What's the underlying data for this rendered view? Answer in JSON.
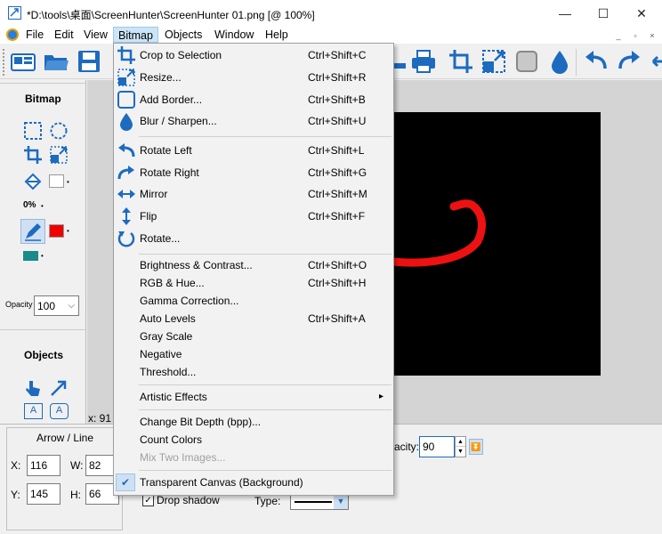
{
  "window": {
    "title": "*D:\\tools\\桌面\\ScreenHunter\\ScreenHunter 01.png [@ 100%]",
    "minimize": "—",
    "maximize": "☐",
    "close": "✕"
  },
  "menubar": {
    "items": [
      "File",
      "Edit",
      "View",
      "Bitmap",
      "Objects",
      "Window",
      "Help"
    ],
    "mdi": [
      "_",
      "▫",
      "×"
    ]
  },
  "left_panel": {
    "bitmap_title": "Bitmap",
    "zoom_value": "0%",
    "opacity_label": "Opacity",
    "opacity_value": "100",
    "objects_title": "Objects",
    "text_tool_a": "A",
    "text_tool_b": "A"
  },
  "canvas": {
    "coords": "x: 91"
  },
  "bottom_panel": {
    "section_title": "Arrow / Line",
    "x_label": "X:",
    "x_value": "116",
    "y_label": "Y:",
    "y_value": "145",
    "w_label": "W:",
    "w_value": "82",
    "h_label": "H:",
    "h_value": "66",
    "drop_shadow": "Drop shadow",
    "type_label": "Type:",
    "opacity_label": "acity:",
    "opacity_value": "90"
  },
  "bitmap_menu": {
    "items": [
      {
        "label": "Crop to Selection",
        "shortcut": "Ctrl+Shift+C",
        "icon": "crop-icon"
      },
      {
        "label": "Resize...",
        "shortcut": "Ctrl+Shift+R",
        "icon": "resize-icon"
      },
      {
        "label": "Add Border...",
        "shortcut": "Ctrl+Shift+B",
        "icon": "border-icon"
      },
      {
        "label": "Blur / Sharpen...",
        "shortcut": "Ctrl+Shift+U",
        "icon": "drop-icon"
      },
      {
        "label": "Rotate Left",
        "shortcut": "Ctrl+Shift+L",
        "icon": "rotate-left-icon"
      },
      {
        "label": "Rotate Right",
        "shortcut": "Ctrl+Shift+G",
        "icon": "rotate-right-icon"
      },
      {
        "label": "Mirror",
        "shortcut": "Ctrl+Shift+M",
        "icon": "mirror-icon"
      },
      {
        "label": "Flip",
        "shortcut": "Ctrl+Shift+F",
        "icon": "flip-icon"
      },
      {
        "label": "Rotate...",
        "shortcut": "",
        "icon": "rotate-icon"
      },
      {
        "label": "Brightness & Contrast...",
        "shortcut": "Ctrl+Shift+O"
      },
      {
        "label": "RGB & Hue...",
        "shortcut": "Ctrl+Shift+H"
      },
      {
        "label": "Gamma Correction...",
        "shortcut": ""
      },
      {
        "label": "Auto Levels",
        "shortcut": "Ctrl+Shift+A"
      },
      {
        "label": "Gray Scale",
        "shortcut": ""
      },
      {
        "label": "Negative",
        "shortcut": ""
      },
      {
        "label": "Threshold...",
        "shortcut": ""
      },
      {
        "label": "Artistic Effects",
        "shortcut": "",
        "submenu": "▸"
      },
      {
        "label": "Change Bit Depth (bpp)...",
        "shortcut": ""
      },
      {
        "label": "Count Colors",
        "shortcut": ""
      },
      {
        "label": "Mix Two Images...",
        "shortcut": "",
        "disabled": true
      },
      {
        "label": "Transparent Canvas (Background)",
        "shortcut": "",
        "checked": true
      }
    ]
  },
  "colors": {
    "accent": "#1c6bbf",
    "red_swatch": "#ee0000",
    "teal_swatch": "#1a8a8a",
    "canvas_bg": "#000000",
    "stroke": "#ee1111"
  }
}
